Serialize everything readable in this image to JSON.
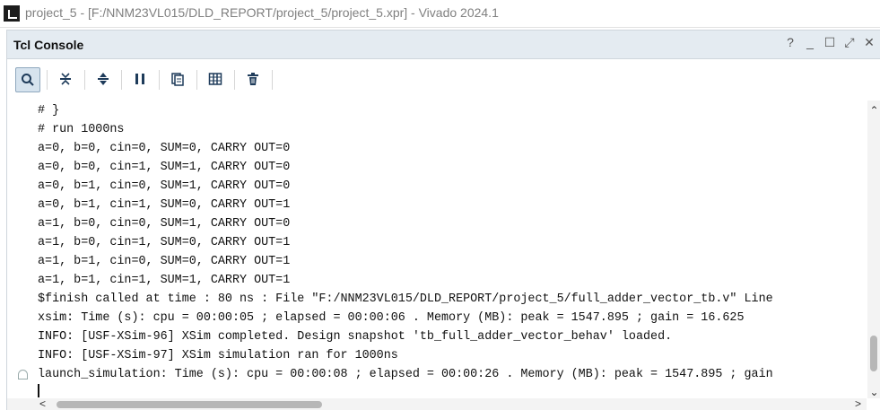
{
  "window": {
    "title": "project_5 - [F:/NNM23VL015/DLD_REPORT/project_5/project_5.xpr] - Vivado 2024.1"
  },
  "panel": {
    "title": "Tcl Console",
    "controls": [
      "?",
      "_",
      "☐",
      "⤢",
      "✕"
    ]
  },
  "toolbar": {
    "buttons": [
      {
        "name": "search-icon",
        "glyph": "🔍"
      },
      {
        "name": "collapse-all-icon",
        "glyph": "⏶"
      },
      {
        "name": "expand-all-icon",
        "glyph": "⬍"
      },
      {
        "name": "pause-icon",
        "glyph": "❚❚"
      },
      {
        "name": "copy-icon",
        "glyph": "❐"
      },
      {
        "name": "table-icon",
        "glyph": "▥"
      },
      {
        "name": "clear-icon",
        "glyph": "🗑"
      }
    ]
  },
  "console": {
    "lines": [
      "# }",
      "# run 1000ns",
      "a=0, b=0, cin=0, SUM=0, CARRY OUT=0",
      "a=0, b=0, cin=1, SUM=1, CARRY OUT=0",
      "a=0, b=1, cin=0, SUM=1, CARRY OUT=0",
      "a=0, b=1, cin=1, SUM=0, CARRY OUT=1",
      "a=1, b=0, cin=0, SUM=1, CARRY OUT=0",
      "a=1, b=0, cin=1, SUM=0, CARRY OUT=1",
      "a=1, b=1, cin=0, SUM=0, CARRY OUT=1",
      "a=1, b=1, cin=1, SUM=1, CARRY OUT=1",
      "$finish called at time : 80 ns : File \"F:/NNM23VL015/DLD_REPORT/project_5/full_adder_vector_tb.v\" Line",
      "xsim: Time (s): cpu = 00:00:05 ; elapsed = 00:00:06 . Memory (MB): peak = 1547.895 ; gain = 16.625",
      "INFO: [USF-XSim-96] XSim completed. Design snapshot 'tb_full_adder_vector_behav' loaded.",
      "INFO: [USF-XSim-97] XSim simulation ran for 1000ns",
      "launch_simulation: Time (s): cpu = 00:00:08 ; elapsed = 00:00:26 . Memory (MB): peak = 1547.895 ; gain"
    ]
  },
  "scrollbars": {
    "up_glyph": "⌃",
    "down_glyph": "⌄",
    "left_glyph": "<",
    "right_glyph": ">"
  }
}
